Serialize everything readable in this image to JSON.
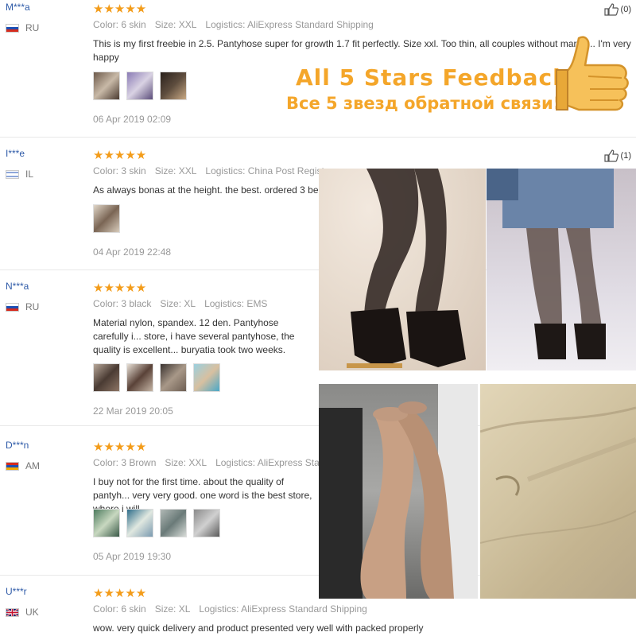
{
  "reviews": [
    {
      "user": "M***a",
      "country": "RU",
      "stars": "★★★★★",
      "color": "Color: 6 skin",
      "size": "Size: XXL",
      "logistics": "Logistics: AliExpress Standard Shipping",
      "text": "This is my first freebie in 2.5. Pantyhose super for growth 1.7 fit perfectly. Size xxl. Too thin, all couples without marria... I'm very happy",
      "date": "06 Apr 2019 02:09",
      "helpful": "(0)"
    },
    {
      "user": "I***e",
      "country": "IL",
      "stars": "★★★★★",
      "color": "Color: 3 skin",
      "size": "Size: XXL",
      "logistics": "Logistics: China Post Register...",
      "text": "As always bonas at the height. the best. ordered 3 beig...",
      "date": "04 Apr 2019 22:48",
      "helpful": "(1)"
    },
    {
      "user": "N***a",
      "country": "RU",
      "stars": "★★★★★",
      "color": "Color: 3 black",
      "size": "Size: XL",
      "logistics": "Logistics: EMS",
      "text": "Material nylon, spandex. 12 den. Pantyhose carefully i... store, i have several pantyhose, the quality is excellent... buryatia took two weeks.",
      "date": "22 Mar 2019 20:05",
      "helpful": ""
    },
    {
      "user": "D***n",
      "country": "AM",
      "stars": "★★★★★",
      "color": "Color: 3 Brown",
      "size": "Size: XXL",
      "logistics": "Logistics: AliExpress Stand...",
      "text": "I buy not for the first time. about the quality of pantyh... very very good. one word is the best store, where i will...",
      "date": "05 Apr 2019 19:30",
      "helpful": ""
    },
    {
      "user": "U***r",
      "country": "UK",
      "stars": "★★★★★",
      "color": "Color: 6 skin",
      "size": "Size: XL",
      "logistics": "Logistics: AliExpress Standard Shipping",
      "text": "wow. very quick delivery and product presented very well with packed properly",
      "date": "",
      "helpful": ""
    }
  ],
  "banner": {
    "line1": "All 5 Stars Feedback",
    "line2": "Все 5 звезд обратной связи!"
  },
  "colors": {
    "accent": "#f39c1a",
    "link": "#2f5ba8",
    "banner": "#f4a62a"
  },
  "icons": {
    "like": "thumbs-up-icon",
    "thumb_big": "big-thumbs-up-icon"
  }
}
